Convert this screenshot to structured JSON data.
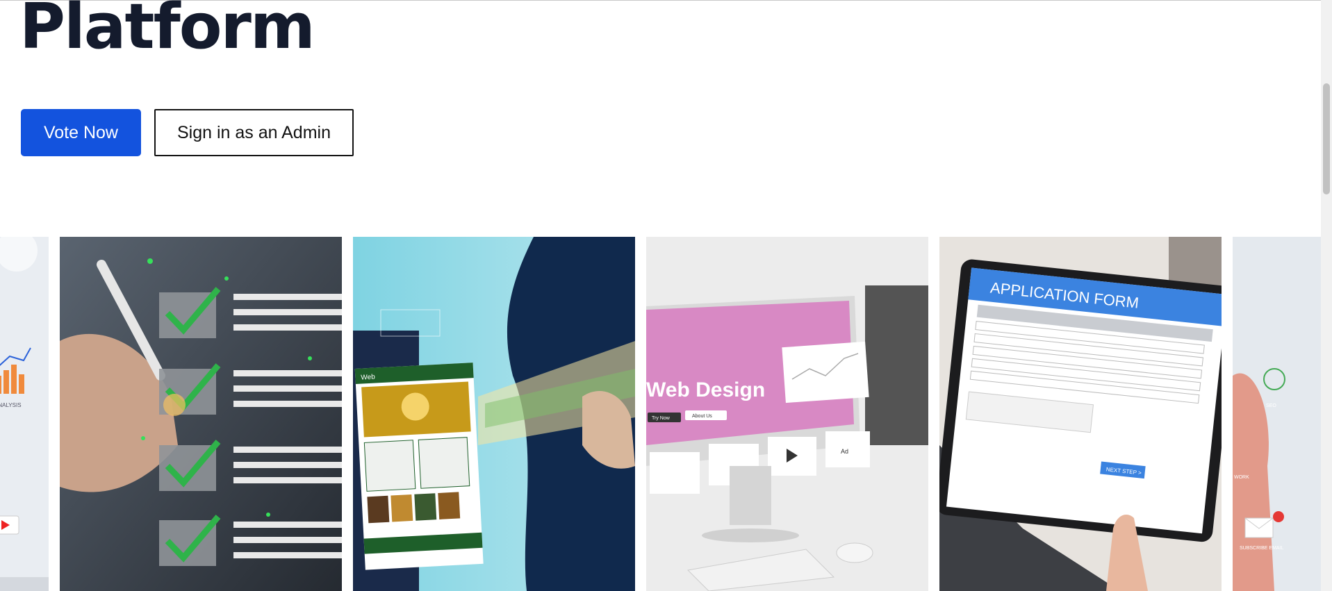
{
  "hero": {
    "title": "Platform",
    "vote_button": "Vote Now",
    "admin_button": "Sign in as an Admin",
    "primary_color": "#1353de"
  },
  "gallery": {
    "images": [
      {
        "subject": "analytics-dashboard",
        "labels": {
          "analysis": "ANALYSIS"
        }
      },
      {
        "subject": "checklist-touch"
      },
      {
        "subject": "website-screens",
        "labels": {
          "brand": "Web"
        }
      },
      {
        "subject": "web-design-monitor",
        "labels": {
          "heading": "Web Design",
          "cta1": "Try Now",
          "cta2": "About Us",
          "ad": "Ad"
        }
      },
      {
        "subject": "tablet-application-form",
        "labels": {
          "form_title": "APPLICATION FORM",
          "next": "NEXT STEP >"
        }
      },
      {
        "subject": "digital-marketing-icons",
        "labels": {
          "seo": "SEO",
          "work": "WORK",
          "subscribe": "SUBSCRIBE EMAIL"
        }
      }
    ]
  }
}
